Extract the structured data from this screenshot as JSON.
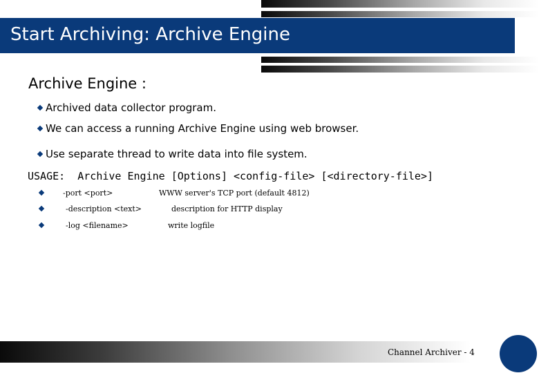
{
  "slide": {
    "title": "Start Archiving: Archive Engine",
    "heading": "Archive Engine :",
    "bullets": [
      "Archived data collector program.",
      "We can access a running Archive Engine using web browser.",
      "Use separate thread to write data into file system."
    ],
    "usage": "USAGE:  Archive Engine [Options] <config-file> [<directory-file>]",
    "options": [
      {
        "name": "-port <port>",
        "description": "WWW server's TCP port (default 4812)"
      },
      {
        "name": "-description <text>",
        "description": "description for HTTP display"
      },
      {
        "name": "-log <filename>",
        "description": "write logfile"
      }
    ],
    "footer": "Channel Archiver - 4"
  },
  "colors": {
    "accent": "#0a3a7a",
    "title_text": "#ffffff",
    "body_text": "#000000"
  },
  "icons": {
    "bullet": "diamond-bullet-icon",
    "footer_mark": "circle-logo-icon"
  }
}
